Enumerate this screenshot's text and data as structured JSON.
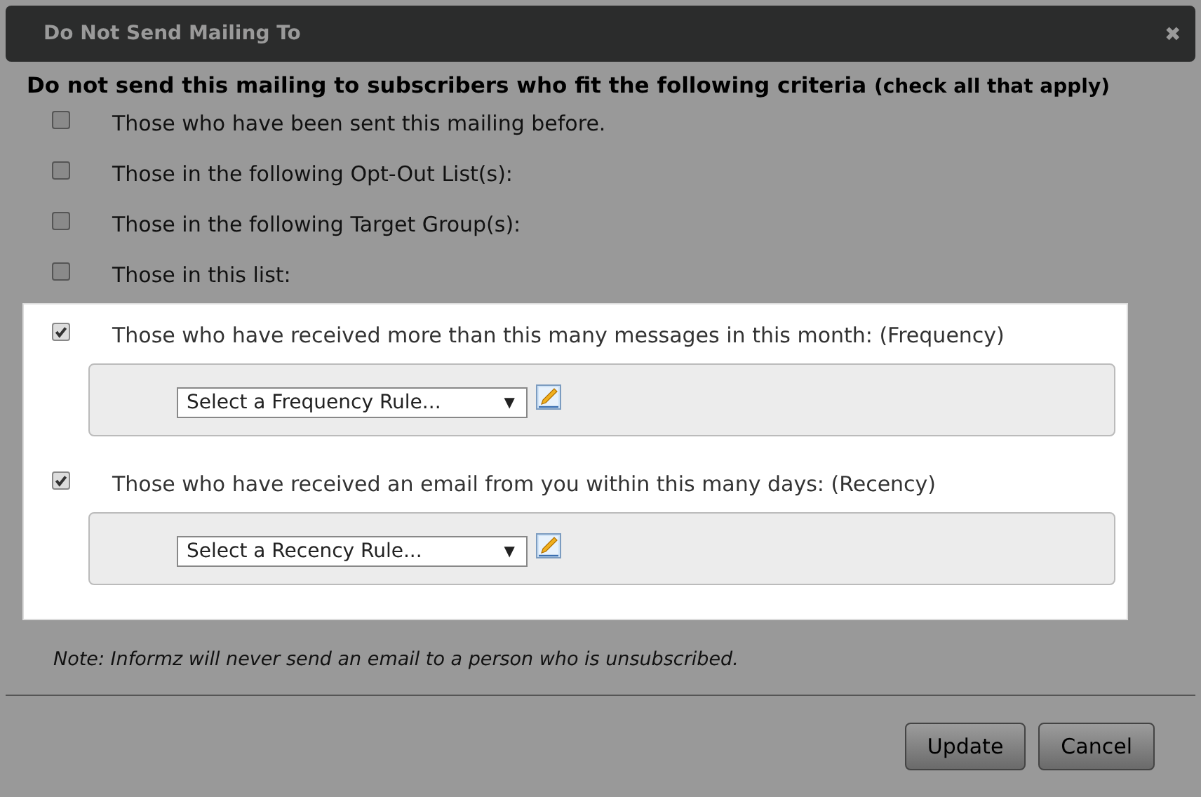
{
  "window": {
    "title": "Do Not Send Mailing To",
    "close": "✖"
  },
  "heading": {
    "text": "Do not send this mailing to subscribers who fit the following criteria",
    "hint": "(check all that apply)"
  },
  "criteria": [
    {
      "label": "Those who have been sent this mailing before.",
      "checked": false
    },
    {
      "label": "Those in the following Opt-Out List(s):",
      "checked": false
    },
    {
      "label": "Those in the following Target Group(s):",
      "checked": false
    },
    {
      "label": "Those in this list:",
      "checked": false
    }
  ],
  "highlighted_criteria": [
    {
      "label": "Those who have received more than this many messages in this month: (Frequency)",
      "checked": true,
      "rule_select": {
        "value": "Select a Frequency Rule...",
        "arrow": "▼"
      }
    },
    {
      "label": "Those who have received an email from you within this many days: (Recency)",
      "checked": true,
      "rule_select": {
        "value": "Select a Recency Rule...",
        "arrow": "▼"
      }
    }
  ],
  "note": "Note: Informz will never send an email to a person who is unsubscribed.",
  "buttons": [
    "Update",
    "Cancel"
  ]
}
